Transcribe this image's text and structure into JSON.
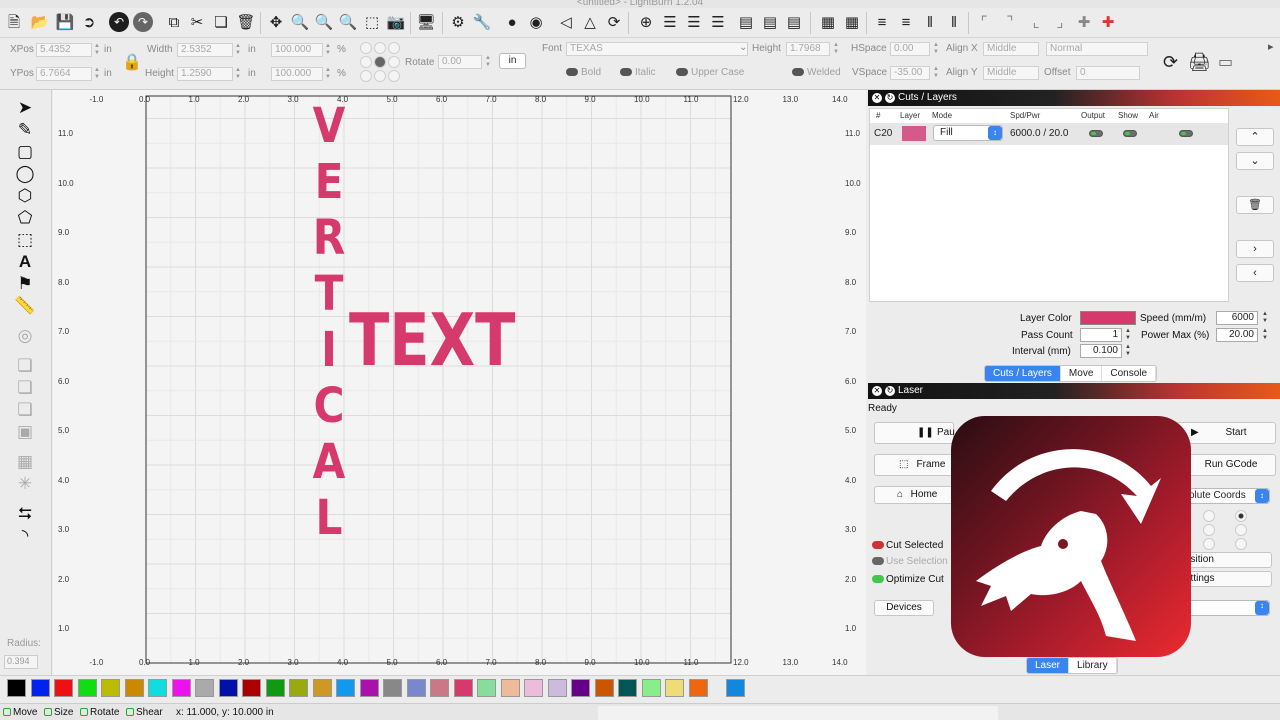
{
  "window": {
    "title": "<untitled> - LightBurn 1.2.04"
  },
  "toolbar2": {
    "xpos_label": "XPos",
    "xpos_value": "5.4352",
    "ypos_label": "YPos",
    "ypos_value": "6.7664",
    "width_label": "Width",
    "width_value": "2.5352",
    "height_label": "Height",
    "height_value": "1.2590",
    "unit": "in",
    "pct_w": "100.000",
    "pct_h": "100.000",
    "pct": "%",
    "rotate_label": "Rotate",
    "rotate_value": "0.00",
    "in_button": "in",
    "font_label": "Font",
    "font_value": "TEXAS",
    "fheight_label": "Height",
    "fheight_value": "1.7968",
    "hspace_label": "HSpace",
    "hspace_value": "0.00",
    "vspace_label": "VSpace",
    "vspace_value": "-35.00",
    "alignx_label": "Align X",
    "alignx_value": "Middle",
    "aligny_label": "Align Y",
    "aligny_value": "Middle",
    "normal_value": "Normal",
    "offset_label": "Offset",
    "offset_value": "0",
    "bold": "Bold",
    "italic": "Italic",
    "upper": "Upper Case",
    "welded": "Welded"
  },
  "lefttools": {
    "radius_label": "Radius:",
    "radius_value": "0.394"
  },
  "canvas": {
    "top_ticks": [
      "-1.0",
      "0.0",
      "1.0",
      "2.0",
      "3.0",
      "4.0",
      "5.0",
      "6.0",
      "7.0",
      "8.0",
      "9.0",
      "10.0",
      "11.0",
      "12.0",
      "13.0",
      "14.0"
    ],
    "bottom_ticks": [
      "-1.0",
      "0.0",
      "1.0",
      "2.0",
      "3.0",
      "4.0",
      "5.0",
      "6.0",
      "7.0",
      "8.0",
      "9.0",
      "10.0",
      "11.0",
      "12.0",
      "13.0",
      "14.0"
    ],
    "left_ticks": [
      "11.0",
      "10.0",
      "9.0",
      "8.0",
      "7.0",
      "6.0",
      "5.0",
      "4.0",
      "3.0",
      "2.0",
      "1.0"
    ],
    "right_ticks": [
      "11.0",
      "10.0",
      "9.0",
      "8.0",
      "7.0",
      "6.0",
      "5.0",
      "4.0",
      "3.0",
      "2.0",
      "1.0"
    ],
    "vertical_text": [
      "V",
      "E",
      "R",
      "T",
      "I",
      "C",
      "A",
      "L"
    ],
    "horizontal_text": "TEXT",
    "text_color": "#d6396b"
  },
  "cuts": {
    "title": "Cuts / Layers",
    "headers": [
      "#",
      "Layer",
      "Mode",
      "Spd/Pwr",
      "Output",
      "Show",
      "Air"
    ],
    "row": {
      "num": "C20",
      "color": "#d45a8c",
      "mode": "Fill",
      "spdpwr": "6000.0 / 20.0"
    },
    "layer_color_label": "Layer Color",
    "layer_color": "#d6396b",
    "speed_label": "Speed (mm/m)",
    "speed_value": "6000",
    "pass_label": "Pass Count",
    "pass_value": "1",
    "power_label": "Power Max (%)",
    "power_value": "20.00",
    "interval_label": "Interval (mm)",
    "interval_value": "0.100",
    "tabs": [
      "Cuts / Layers",
      "Move",
      "Console"
    ]
  },
  "laser": {
    "title": "Laser",
    "status": "Ready",
    "pause": "Pau",
    "start": "Start",
    "frame": "Frame",
    "run_gcode": "Run GCode",
    "home": "Home",
    "coords": "olute Coords",
    "cut_selected": "Cut Selected",
    "use_selection": "Use Selection",
    "optimize": "Optimize Cut",
    "position": "osition",
    "settings": "ettings",
    "devices": "Devices",
    "tabs": [
      "Laser",
      "Library"
    ]
  },
  "palette": [
    "#000000",
    "#0022ee",
    "#ee1111",
    "#11dd11",
    "#bbbb00",
    "#cc8800",
    "#11dddd",
    "#ee11ee",
    "#aaaaaa",
    "#0011aa",
    "#aa0000",
    "#119911",
    "#99aa11",
    "#cc9922",
    "#1199ee",
    "#aa11aa",
    "#888888",
    "#7788cc",
    "#cc7788",
    "#d6396b",
    "#88dd99",
    "#eebb99",
    "#eebbdd",
    "#ccbbdd",
    "#660088",
    "#cc5500",
    "#005555",
    "#88ee88",
    "#eedd77",
    "#ee6611",
    "#1188dd"
  ],
  "status": {
    "move": "Move",
    "size": "Size",
    "rotate": "Rotate",
    "shear": "Shear",
    "coords": "x: 11.000, y: 10.000 in"
  }
}
